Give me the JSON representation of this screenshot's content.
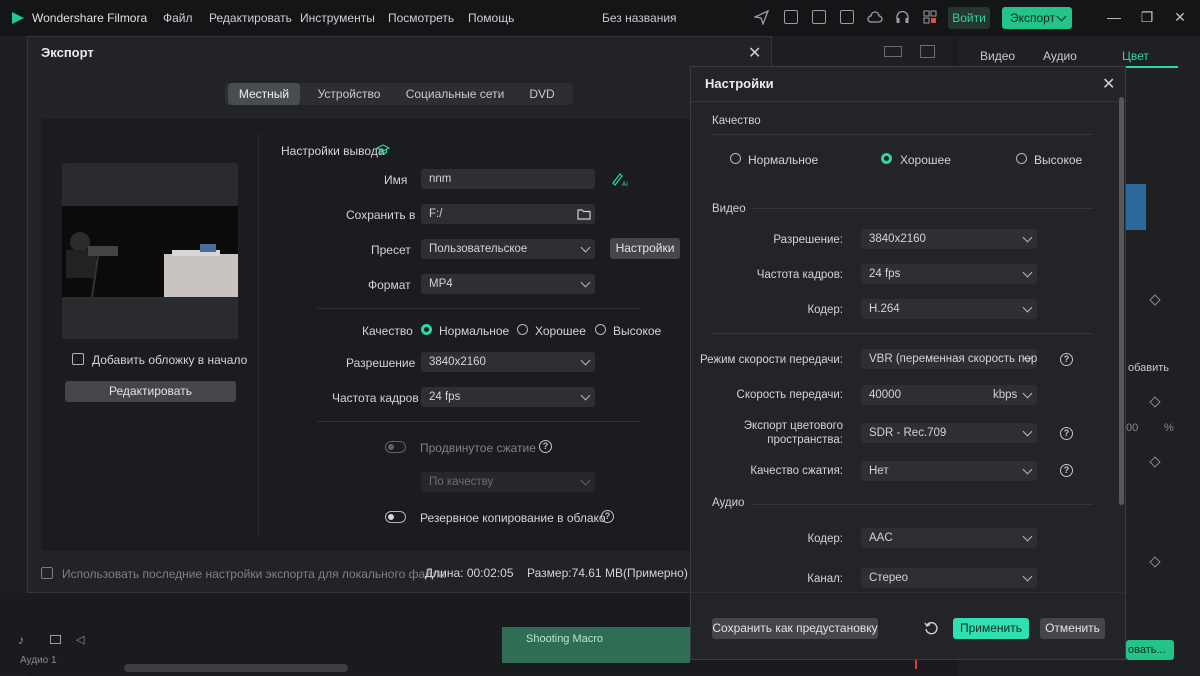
{
  "app": {
    "title": "Wondershare Filmora",
    "menu": [
      "Файл",
      "Редактировать",
      "Инструменты",
      "Посмотреть",
      "Помощь"
    ],
    "project_name": "Без названия",
    "login_label": "Войти",
    "export_label": "Экспорт"
  },
  "export_dialog": {
    "title": "Экспорт",
    "tabs": [
      "Местный",
      "Устройство",
      "Социальные сети",
      "DVD"
    ],
    "active_tab": "Местный",
    "add_cover_label": "Добавить обложку в начало",
    "edit_button": "Редактировать",
    "output_settings_label": "Настройки вывода",
    "name_label": "Имя",
    "name_value": "nnm",
    "save_to_label": "Сохранить в",
    "save_to_value": "F:/",
    "preset_label": "Пресет",
    "preset_value": "Пользовательское",
    "settings_button": "Настройки",
    "format_label": "Формат",
    "format_value": "MP4",
    "quality_label": "Качество",
    "quality_options": [
      "Нормальное",
      "Хорошее",
      "Высокое"
    ],
    "quality_selected": "Нормальное",
    "resolution_label": "Разрешение",
    "resolution_value": "3840x2160",
    "framerate_label": "Частота кадров",
    "framerate_value": "24 fps",
    "advanced_compression_label": "Продвинутое сжатие",
    "compression_mode_value": "По качеству",
    "cloud_backup_label": "Резервное копирование в облако",
    "use_last_settings_label": "Использовать последние настройки экспорта для локального файла",
    "duration_label": "Длина:",
    "duration_value": "00:02:05",
    "size_label": "Размер:",
    "size_value": "74.61 MB(Примерно)"
  },
  "settings_dialog": {
    "title": "Настройки",
    "quality_section": "Качество",
    "quality_options": [
      "Нормальное",
      "Хорошее",
      "Высокое"
    ],
    "quality_selected": "Хорошее",
    "video_section": "Видео",
    "resolution_label": "Разрешение:",
    "resolution_value": "3840x2160",
    "framerate_label": "Частота кадров:",
    "framerate_value": "24 fps",
    "encoder_label": "Кодер:",
    "encoder_value": "H.264",
    "bitrate_mode_label": "Режим скорости передачи:",
    "bitrate_mode_value": "VBR (переменная скорость передачи)",
    "bitrate_label": "Скорость передачи:",
    "bitrate_value": "40000",
    "bitrate_unit": "kbps",
    "color_space_label_1": "Экспорт цветового",
    "color_space_label_2": "пространства:",
    "color_space_value": "SDR - Rec.709",
    "compression_quality_label": "Качество сжатия:",
    "compression_quality_value": "Нет",
    "audio_section": "Аудио",
    "audio_encoder_label": "Кодер:",
    "audio_encoder_value": "AAC",
    "channel_label": "Канал:",
    "channel_value": "Стерео",
    "save_preset_button": "Сохранить как предустановку",
    "apply_button": "Применить",
    "cancel_button": "Отменить"
  },
  "background": {
    "right_tabs": [
      "Видео",
      "Аудио",
      "Цвет"
    ],
    "add_label": "обавить",
    "percent_label": "%",
    "zero_label": "00",
    "timeline_clip": "Shooting Macro",
    "audio_track_label": "Аудио 1",
    "bottom_right_button": "овать..."
  },
  "colors": {
    "accent": "#2fd6a3",
    "apply": "#2fe0b0",
    "dialog_bg": "#222327"
  }
}
